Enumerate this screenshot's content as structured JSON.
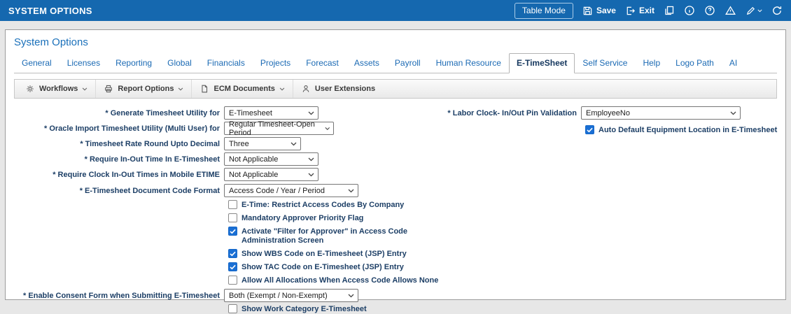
{
  "header": {
    "title": "SYSTEM OPTIONS",
    "buttons": {
      "table_mode": "Table Mode",
      "save": "Save",
      "exit": "Exit"
    }
  },
  "page_title": "System Options",
  "tabs": [
    {
      "label": "General"
    },
    {
      "label": "Licenses"
    },
    {
      "label": "Reporting"
    },
    {
      "label": "Global"
    },
    {
      "label": "Financials"
    },
    {
      "label": "Projects"
    },
    {
      "label": "Forecast"
    },
    {
      "label": "Assets"
    },
    {
      "label": "Payroll"
    },
    {
      "label": "Human Resource"
    },
    {
      "label": "E-TimeSheet",
      "active": true
    },
    {
      "label": "Self Service"
    },
    {
      "label": "Help"
    },
    {
      "label": "Logo Path"
    },
    {
      "label": "AI"
    }
  ],
  "toolbar": {
    "workflows": "Workflows",
    "report_options": "Report Options",
    "ecm_documents": "ECM Documents",
    "user_extensions": "User Extensions"
  },
  "form": {
    "left": {
      "generate_timesheet": {
        "label": "* Generate Timesheet Utility for",
        "value": "E-Timesheet"
      },
      "oracle_import": {
        "label": "* Oracle Import Timesheet Utility (Multi User) for",
        "value": "Regular Timesheet-Open Period"
      },
      "rate_round": {
        "label": "* Timesheet Rate Round Upto Decimal",
        "value": "Three"
      },
      "require_inout": {
        "label": "* Require In-Out Time In E-Timesheet",
        "value": "Not Applicable"
      },
      "require_clock": {
        "label": "* Require Clock In-Out Times in Mobile ETIME",
        "value": "Not Applicable"
      },
      "doc_code_format": {
        "label": "* E-Timesheet Document Code Format",
        "value": "Access Code / Year / Period"
      },
      "consent_form": {
        "label": "* Enable Consent Form when Submitting E-Timesheet",
        "value": "Both (Exempt / Non-Exempt)"
      }
    },
    "checkboxes_left": [
      {
        "label": "E-Time: Restrict Access Codes By Company",
        "checked": false
      },
      {
        "label": "Mandatory Approver Priority Flag",
        "checked": false
      },
      {
        "label": "Activate \"Filter for Approver\" in Access Code Administration Screen",
        "checked": true
      },
      {
        "label": "Show WBS Code on E-Timesheet (JSP) Entry",
        "checked": true
      },
      {
        "label": "Show TAC Code on E-Timesheet (JSP) Entry",
        "checked": true
      },
      {
        "label": "Allow All Allocations When Access Code Allows None",
        "checked": false
      }
    ],
    "checkbox_work_category": {
      "label": "Show Work Category E-Timesheet",
      "checked": false
    },
    "right": {
      "pin_validation": {
        "label": "* Labor Clock- In/Out Pin Validation",
        "value": "EmployeeNo"
      },
      "auto_default": {
        "label": "Auto Default Equipment Location in E-Timesheet",
        "checked": true
      }
    }
  }
}
